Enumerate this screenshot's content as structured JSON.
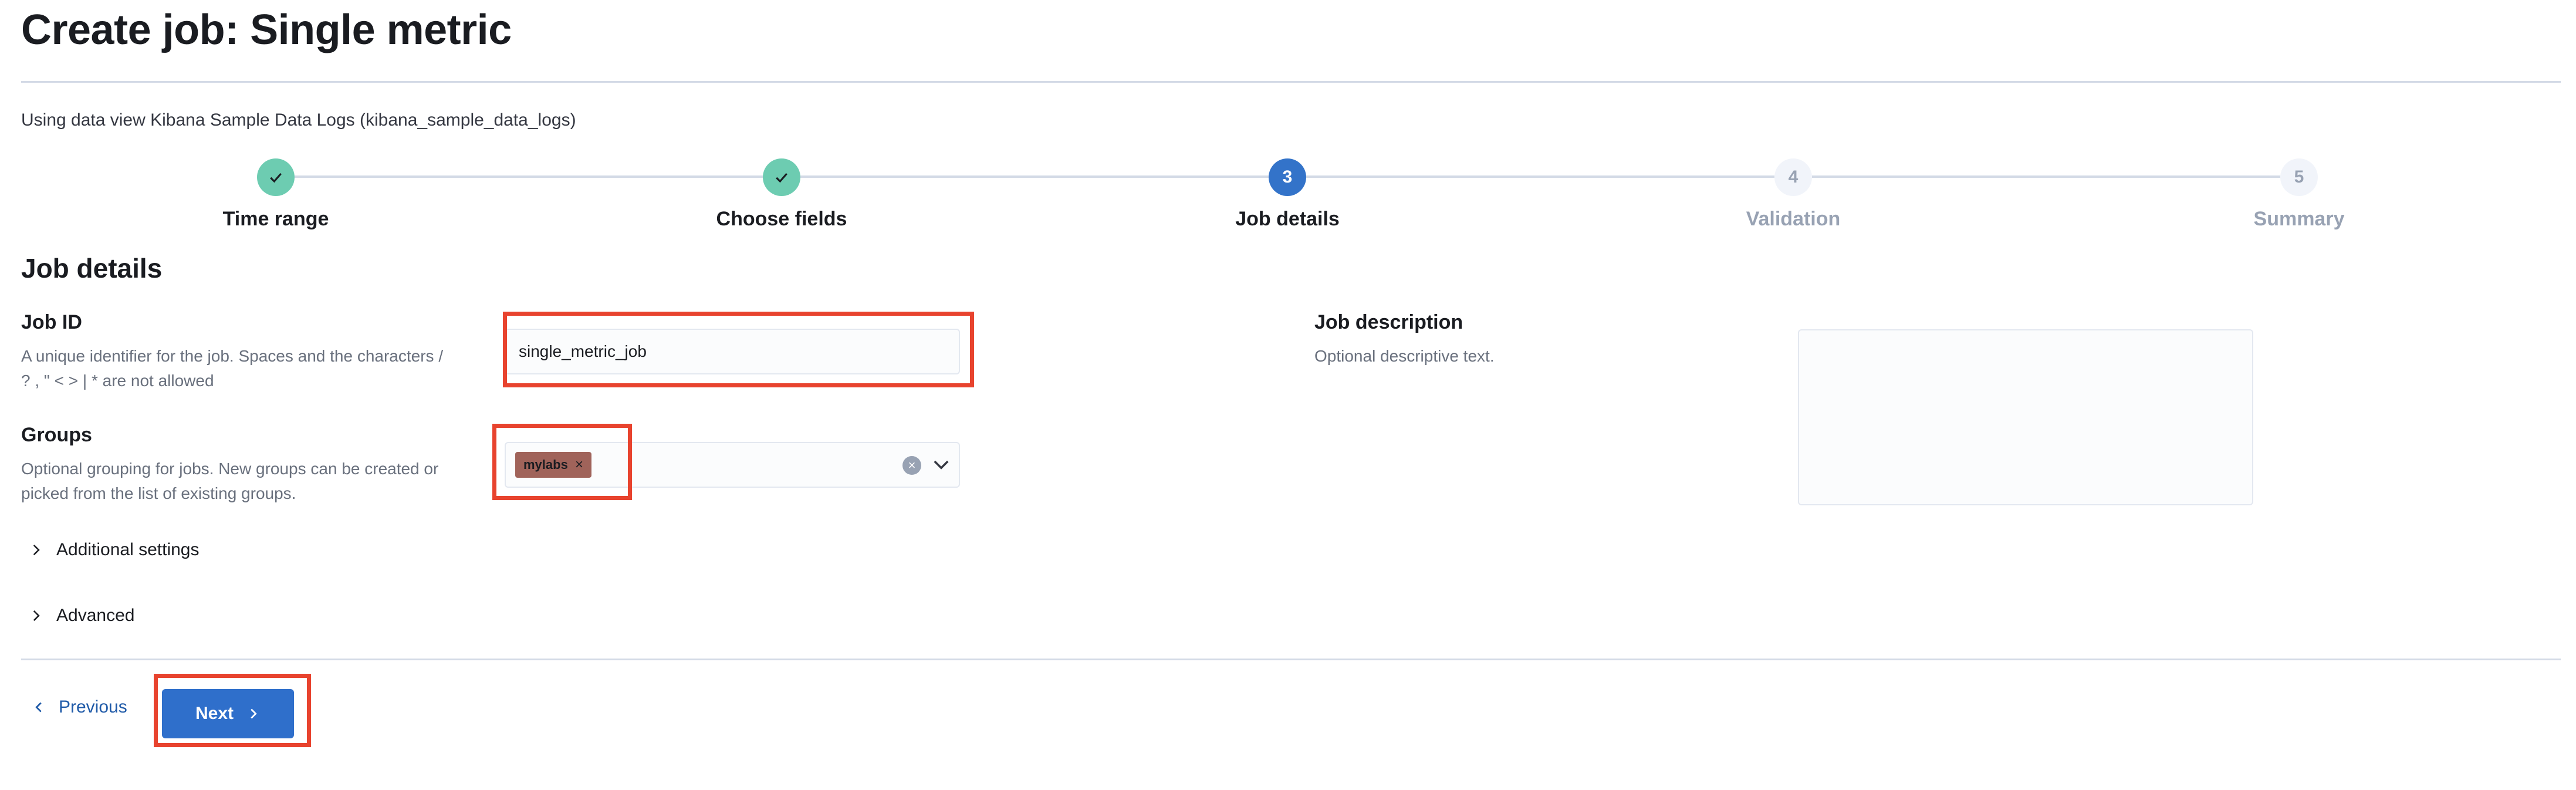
{
  "page": {
    "title": "Create job: Single metric",
    "data_view_text": "Using data view Kibana Sample Data Logs (kibana_sample_data_logs)"
  },
  "stepper": {
    "steps": [
      {
        "number": "1",
        "label": "Time range",
        "status": "complete"
      },
      {
        "number": "2",
        "label": "Choose fields",
        "status": "complete"
      },
      {
        "number": "3",
        "label": "Job details",
        "status": "current"
      },
      {
        "number": "4",
        "label": "Validation",
        "status": "incomplete"
      },
      {
        "number": "5",
        "label": "Summary",
        "status": "incomplete"
      }
    ]
  },
  "job_details": {
    "section_title": "Job details",
    "job_id": {
      "label": "Job ID",
      "help_line1": "A unique identifier for the job. Spaces and the characters /",
      "help_line2": "? , \" < > | * are not allowed",
      "value": "single_metric_job"
    },
    "groups": {
      "label": "Groups",
      "help_line1": "Optional grouping for jobs. New groups can be created or",
      "help_line2": "picked from the list of existing groups.",
      "selected": "mylabs",
      "remove_glyph": "×"
    },
    "job_description": {
      "label": "Job description",
      "help": "Optional descriptive text.",
      "value": ""
    },
    "additional_settings_label": "Additional settings",
    "advanced_label": "Advanced"
  },
  "footer": {
    "previous_label": "Previous",
    "next_label": "Next"
  },
  "colors": {
    "primary": "#2f6fcb",
    "complete_step": "#6dccb1",
    "group_badge": "#a0635a",
    "highlight_box": "#e8432e"
  }
}
